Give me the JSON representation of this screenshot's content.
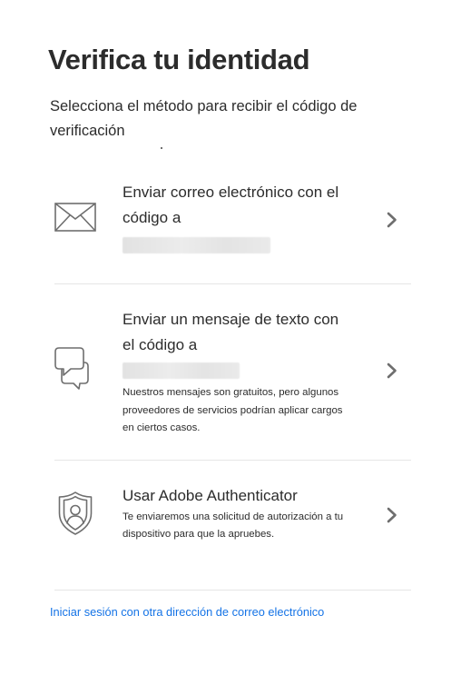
{
  "page": {
    "title": "Verifica tu identidad",
    "subtitle": "Selecciona el método para recibir el código de verificación"
  },
  "options": [
    {
      "title": "Enviar correo electrónico con el código a",
      "icon": "envelope-icon",
      "destination_redacted": true
    },
    {
      "title": "Enviar un mensaje de texto con el código a",
      "icon": "chat-bubbles-icon",
      "destination_redacted": true,
      "description": "Nuestros mensajes son gratuitos, pero algunos proveedores de servicios podrían aplicar cargos en ciertos casos."
    },
    {
      "title": "Usar Adobe Authenticator",
      "icon": "shield-user-icon",
      "description": "Te enviaremos una solicitud de autorización a tu dispositivo para que la apruebes."
    }
  ],
  "footer": {
    "link_label": "Iniciar sesión con otra dirección de correo electrónico"
  },
  "colors": {
    "text": "#2c2c2c",
    "link": "#1473e6",
    "divider": "#e6e6e6",
    "icon": "#6e6e6e"
  }
}
